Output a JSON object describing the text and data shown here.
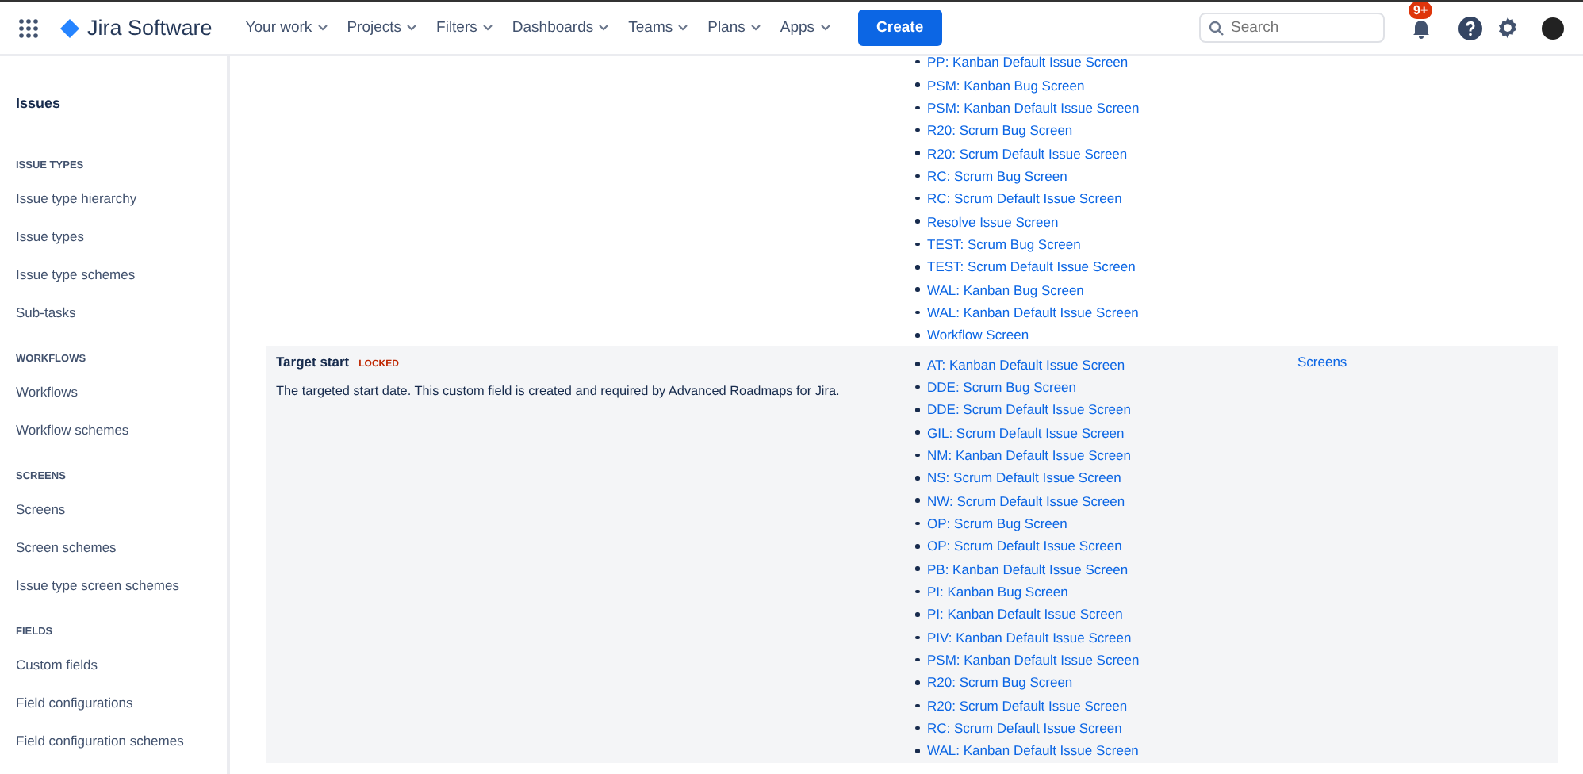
{
  "header": {
    "product": "Jira Software",
    "nav": [
      {
        "label": "Your work"
      },
      {
        "label": "Projects"
      },
      {
        "label": "Filters"
      },
      {
        "label": "Dashboards"
      },
      {
        "label": "Teams"
      },
      {
        "label": "Plans"
      },
      {
        "label": "Apps"
      }
    ],
    "create": "Create",
    "search": {
      "placeholder": "Search"
    },
    "notifications_badge": "9+"
  },
  "sidebar": {
    "title": "Issues",
    "sections": [
      {
        "heading": "ISSUE TYPES",
        "items": [
          "Issue type hierarchy",
          "Issue types",
          "Issue type schemes",
          "Sub-tasks"
        ]
      },
      {
        "heading": "WORKFLOWS",
        "items": [
          "Workflows",
          "Workflow schemes"
        ]
      },
      {
        "heading": "SCREENS",
        "items": [
          "Screens",
          "Screen schemes",
          "Issue type screen schemes"
        ]
      },
      {
        "heading": "FIELDS",
        "items": [
          "Custom fields",
          "Field configurations",
          "Field configuration schemes"
        ]
      }
    ]
  },
  "rows": [
    {
      "name": "",
      "badge": "",
      "description": "",
      "screens": [
        "PP: Kanban Default Issue Screen",
        "PSM: Kanban Bug Screen",
        "PSM: Kanban Default Issue Screen",
        "R20: Scrum Bug Screen",
        "R20: Scrum Default Issue Screen",
        "RC: Scrum Bug Screen",
        "RC: Scrum Default Issue Screen",
        "Resolve Issue Screen",
        "TEST: Scrum Bug Screen",
        "TEST: Scrum Default Issue Screen",
        "WAL: Kanban Bug Screen",
        "WAL: Kanban Default Issue Screen",
        "Workflow Screen"
      ],
      "link": "",
      "highlighted": false
    },
    {
      "name": "Target start",
      "badge": "LOCKED",
      "description": "The targeted start date. This custom field is created and required by Advanced Roadmaps for Jira.",
      "screens": [
        "AT: Kanban Default Issue Screen",
        "DDE: Scrum Bug Screen",
        "DDE: Scrum Default Issue Screen",
        "GIL: Scrum Default Issue Screen",
        "NM: Kanban Default Issue Screen",
        "NS: Scrum Default Issue Screen",
        "NW: Scrum Default Issue Screen",
        "OP: Scrum Bug Screen",
        "OP: Scrum Default Issue Screen",
        "PB: Kanban Default Issue Screen",
        "PI: Kanban Bug Screen",
        "PI: Kanban Default Issue Screen",
        "PIV: Kanban Default Issue Screen",
        "PSM: Kanban Default Issue Screen",
        "R20: Scrum Bug Screen",
        "R20: Scrum Default Issue Screen",
        "RC: Scrum Default Issue Screen",
        "WAL: Kanban Default Issue Screen"
      ],
      "link": "Screens",
      "highlighted": true
    }
  ]
}
